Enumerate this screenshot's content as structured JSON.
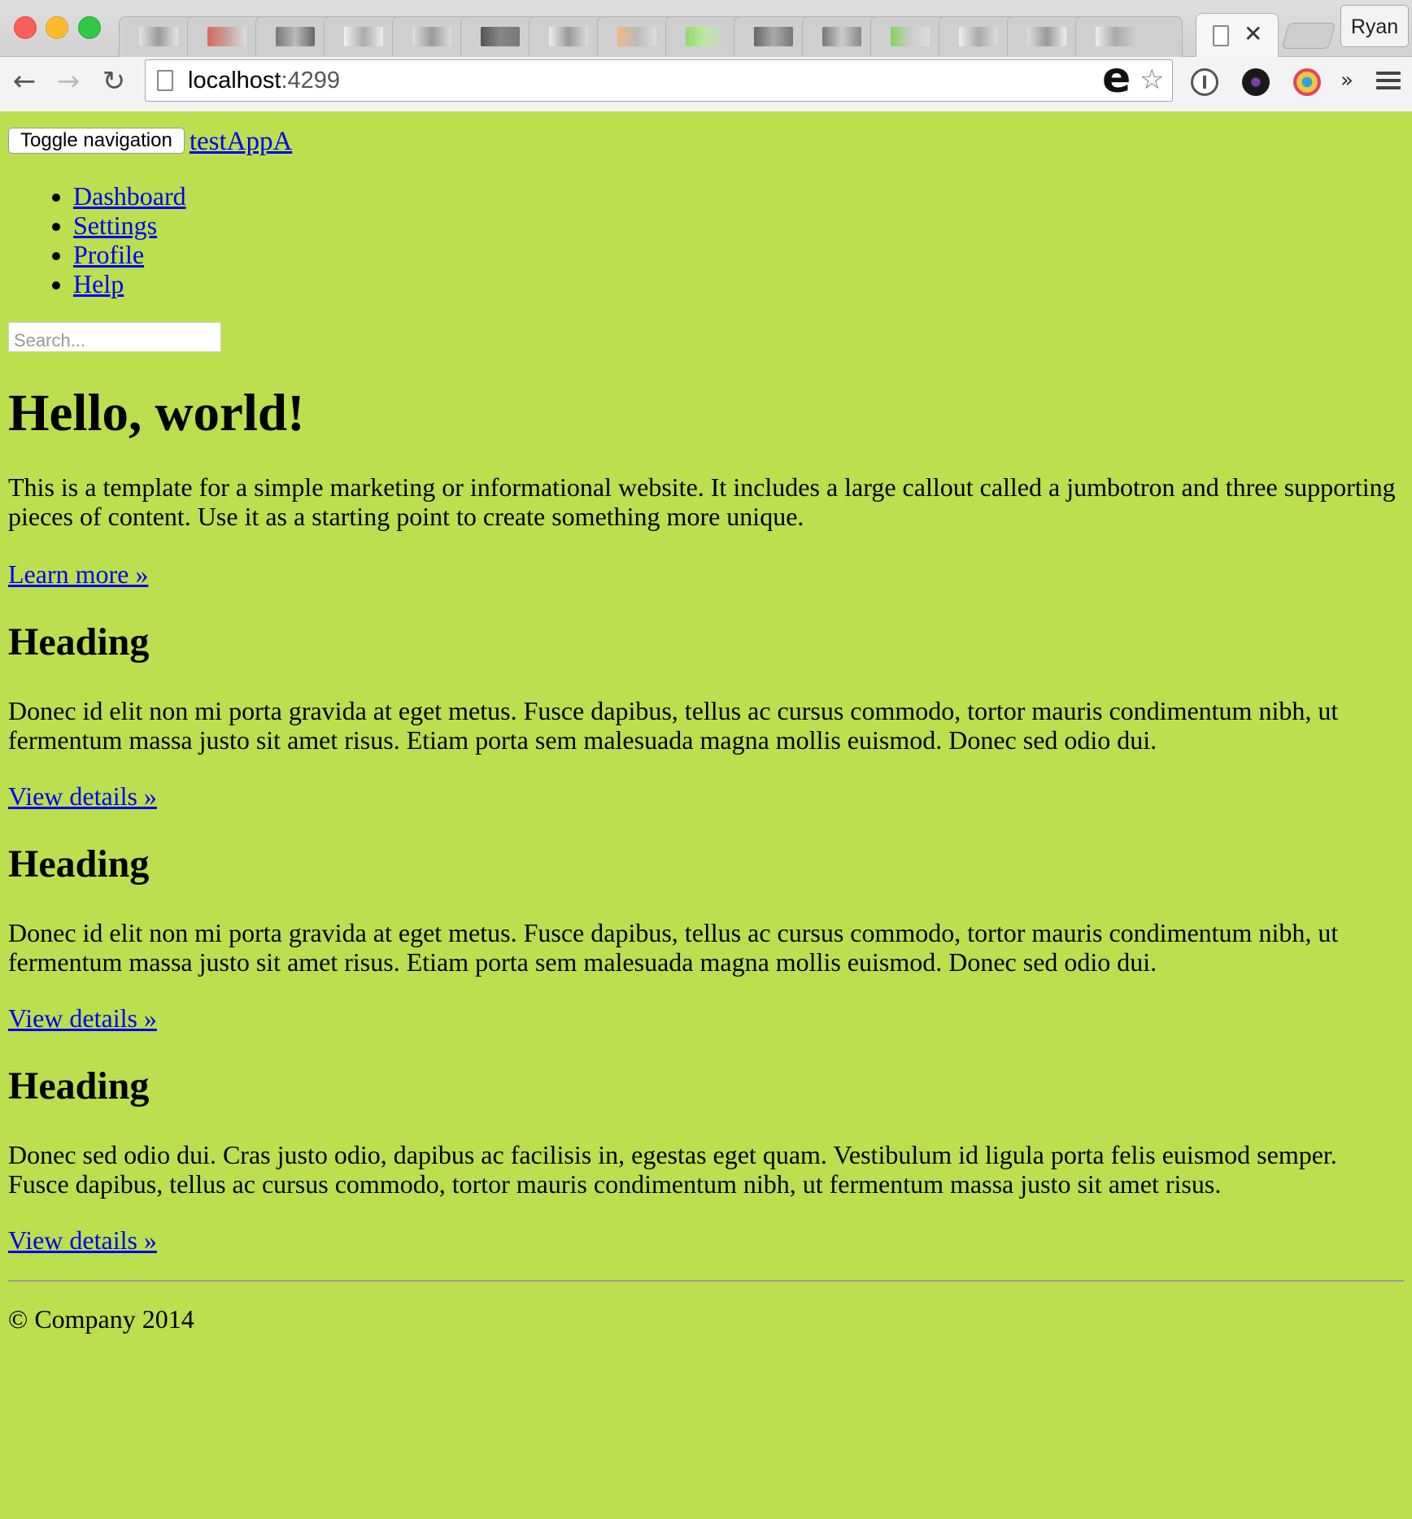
{
  "browser": {
    "url_host": "localhost",
    "url_port": ":4299",
    "profile_name": "Ryan",
    "tab_close_glyph": "✕",
    "extension_e": "e",
    "overflow_glyph": "»"
  },
  "navbar": {
    "toggle_label": "Toggle navigation",
    "brand": "testAppA",
    "items": [
      {
        "label": "Dashboard"
      },
      {
        "label": "Settings"
      },
      {
        "label": "Profile"
      },
      {
        "label": "Help"
      }
    ],
    "search_placeholder": "Search..."
  },
  "jumbotron": {
    "title": "Hello, world!",
    "text": "This is a template for a simple marketing or informational website. It includes a large callout called a jumbotron and three supporting pieces of content. Use it as a starting point to create something more unique.",
    "cta": "Learn more »"
  },
  "sections": [
    {
      "heading": "Heading",
      "text": "Donec id elit non mi porta gravida at eget metus. Fusce dapibus, tellus ac cursus commodo, tortor mauris condimentum nibh, ut fermentum massa justo sit amet risus. Etiam porta sem malesuada magna mollis euismod. Donec sed odio dui.",
      "link": "View details »"
    },
    {
      "heading": "Heading",
      "text": "Donec id elit non mi porta gravida at eget metus. Fusce dapibus, tellus ac cursus commodo, tortor mauris condimentum nibh, ut fermentum massa justo sit amet risus. Etiam porta sem malesuada magna mollis euismod. Donec sed odio dui.",
      "link": "View details »"
    },
    {
      "heading": "Heading",
      "text": "Donec sed odio dui. Cras justo odio, dapibus ac facilisis in, egestas eget quam. Vestibulum id ligula porta felis euismod semper. Fusce dapibus, tellus ac cursus commodo, tortor mauris condimentum nibh, ut fermentum massa justo sit amet risus.",
      "link": "View details »"
    }
  ],
  "footer": {
    "text": "© Company 2014"
  },
  "colors": {
    "page_background": "#bbdf4e",
    "link": "#0000ee"
  }
}
